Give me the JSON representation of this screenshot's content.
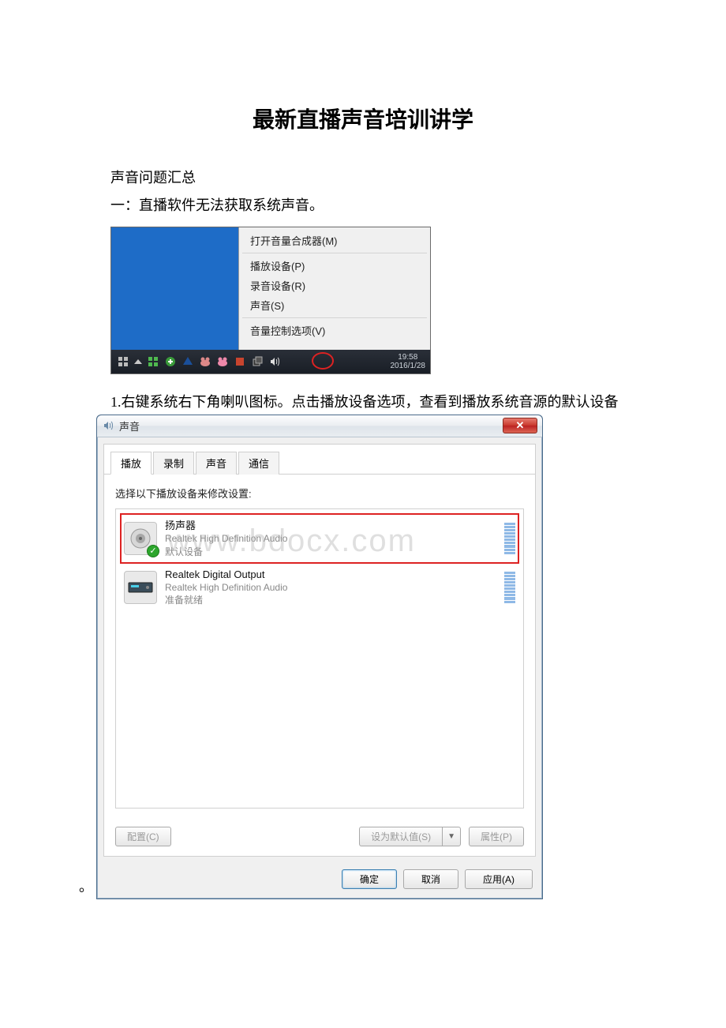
{
  "title": "最新直播声音培训讲学",
  "p1": "声音问题汇总",
  "p2": "一：直播软件无法获取系统声音。",
  "p3": "1.右键系统右下角喇叭图标。点击播放设备选项，查看到播放系统音源的默认设备",
  "period": "。",
  "menu": {
    "m1": "打开音量合成器(M)",
    "m2": "播放设备(P)",
    "m3": "录音设备(R)",
    "m4": "声音(S)",
    "m5": "音量控制选项(V)"
  },
  "clock": {
    "time": "19:58",
    "date": "2016/1/28"
  },
  "dialog": {
    "title": "声音",
    "close": "✕",
    "tabs": {
      "t1": "播放",
      "t2": "录制",
      "t3": "声音",
      "t4": "通信"
    },
    "instr": "选择以下播放设备来修改设置:",
    "dev1": {
      "l1": "扬声器",
      "l2": "Realtek High Definition Audio",
      "l3": "默认设备"
    },
    "dev2": {
      "l1": "Realtek Digital Output",
      "l2": "Realtek High Definition Audio",
      "l3": "准备就绪"
    },
    "watermark": "www.bdocx.com",
    "btn_cfg": "配置(C)",
    "btn_def": "设为默认值(S)",
    "btn_prop": "属性(P)",
    "btn_ok": "确定",
    "btn_cancel": "取消",
    "btn_apply": "应用(A)"
  }
}
